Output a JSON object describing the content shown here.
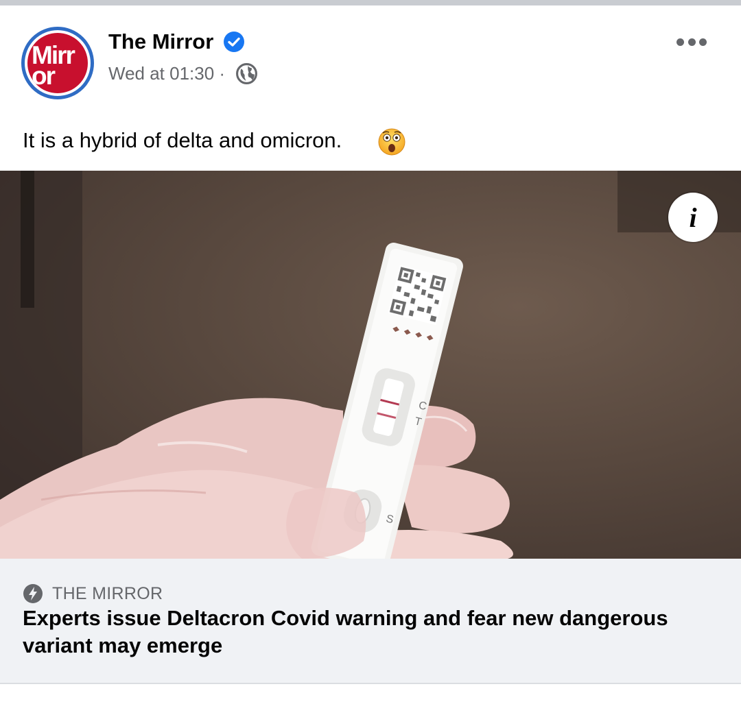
{
  "post": {
    "author": "The Mirror",
    "avatar_text_line1": "Mirr",
    "avatar_text_line2": "or",
    "verified_icon": "verified-badge-icon",
    "timestamp": "Wed at 01:30 ·",
    "audience_icon": "globe-icon",
    "text": "It is a hybrid of delta and omicron.",
    "emoji": "astonished-face-emoji",
    "more_icon": "more-options-icon"
  },
  "image": {
    "info_icon": "info-icon",
    "info_label": "i",
    "test_labels": {
      "c": "C",
      "t": "T",
      "s": "S"
    }
  },
  "link": {
    "source_icon": "instant-article-bolt-icon",
    "source": "THE MIRROR",
    "headline": "Experts issue Deltacron Covid warning and fear new dangerous variant may emerge"
  },
  "colors": {
    "verified": "#1877f2",
    "brand_red": "#c8102e",
    "avatar_ring": "#2f6cc4",
    "link_bg": "#f0f2f5",
    "secondary_text": "#65676b"
  }
}
